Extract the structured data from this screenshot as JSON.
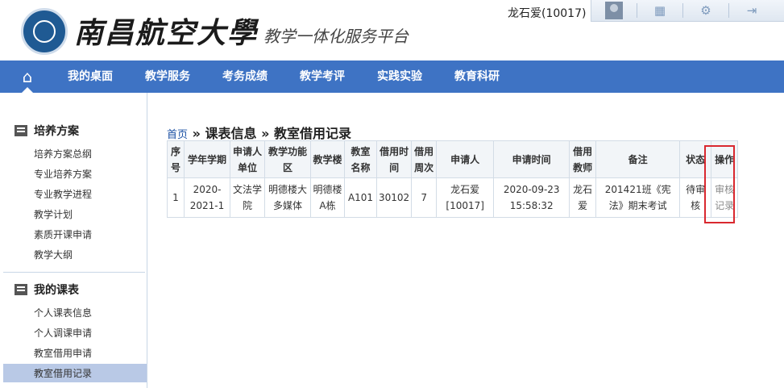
{
  "header": {
    "school_name": "南昌航空大學",
    "platform_name": "教学一体化服务平台",
    "username": "龙石爱(10017)"
  },
  "toolbar": {
    "icons": [
      "avatar",
      "grid-icon",
      "gear-icon",
      "logout-icon"
    ]
  },
  "nav": {
    "items": [
      "我的桌面",
      "教学服务",
      "考务成绩",
      "教学考评",
      "实践实验",
      "教育科研"
    ]
  },
  "sidebar": {
    "sections": [
      {
        "title": "培养方案",
        "items": [
          "培养方案总纲",
          "专业培养方案",
          "专业教学进程",
          "教学计划",
          "素质开课申请",
          "教学大纲"
        ]
      },
      {
        "title": "我的课表",
        "items": [
          "个人课表信息",
          "个人调课申请",
          "教室借用申请",
          "教室借用记录"
        ]
      }
    ],
    "active_item": "教室借用记录"
  },
  "breadcrumb": {
    "home": "首页",
    "sep": "»",
    "level1": "课表信息",
    "level2": "教室借用记录"
  },
  "table": {
    "headers": [
      "序号",
      "学年学期",
      "申请人单位",
      "教学功能区",
      "教学楼",
      "教室名称",
      "借用时间",
      "借用周次",
      "申请人",
      "申请时间",
      "借用教师",
      "备注",
      "状态",
      "操作"
    ],
    "rows": [
      {
        "index": "1",
        "term": "2020-2021-1",
        "unit": "文法学院",
        "zone": "明德楼大多媒体",
        "building": "明德楼A栋",
        "room": "A101",
        "time": "30102",
        "week": "7",
        "applicant": "龙石爱[10017]",
        "apply_time": "2020-09-23 15:58:32",
        "teacher": "龙石爱",
        "remark": "201421班《宪法》期末考试",
        "status": "待审核",
        "action": "审核记录"
      }
    ]
  },
  "colors": {
    "nav_bg": "#3e73c4",
    "highlight": "#d9282f",
    "active_sidebar": "#b9c9e6"
  }
}
